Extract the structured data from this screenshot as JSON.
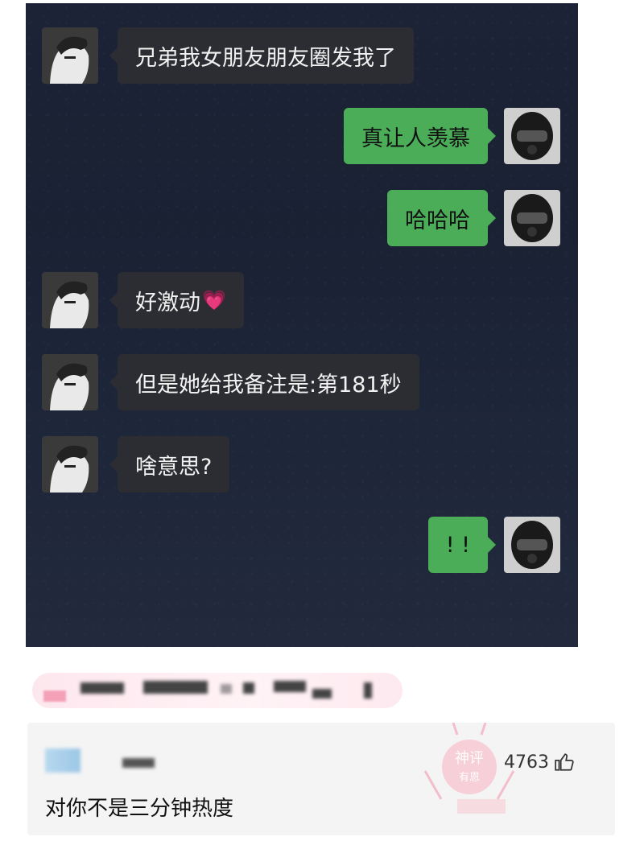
{
  "messages": [
    {
      "side": "left",
      "text": "兄弟我女朋友朋友圈发我了"
    },
    {
      "side": "right",
      "text": "真让人羡慕"
    },
    {
      "side": "right",
      "text": "哈哈哈"
    },
    {
      "side": "left",
      "text": "好激动",
      "emoji": "💗"
    },
    {
      "side": "left",
      "text": "但是她给我备注是:第181秒"
    },
    {
      "side": "left",
      "text": "啥意思?"
    },
    {
      "side": "right",
      "text": "! !"
    }
  ],
  "comment": {
    "text": "对你不是三分钟热度",
    "likes": "4763",
    "stamp_text_top": "神评",
    "stamp_text_bottom": "有恩"
  },
  "colors": {
    "left_bubble": "#2c2d33",
    "right_bubble": "#4cad59",
    "chat_bg": "#1c2336"
  }
}
